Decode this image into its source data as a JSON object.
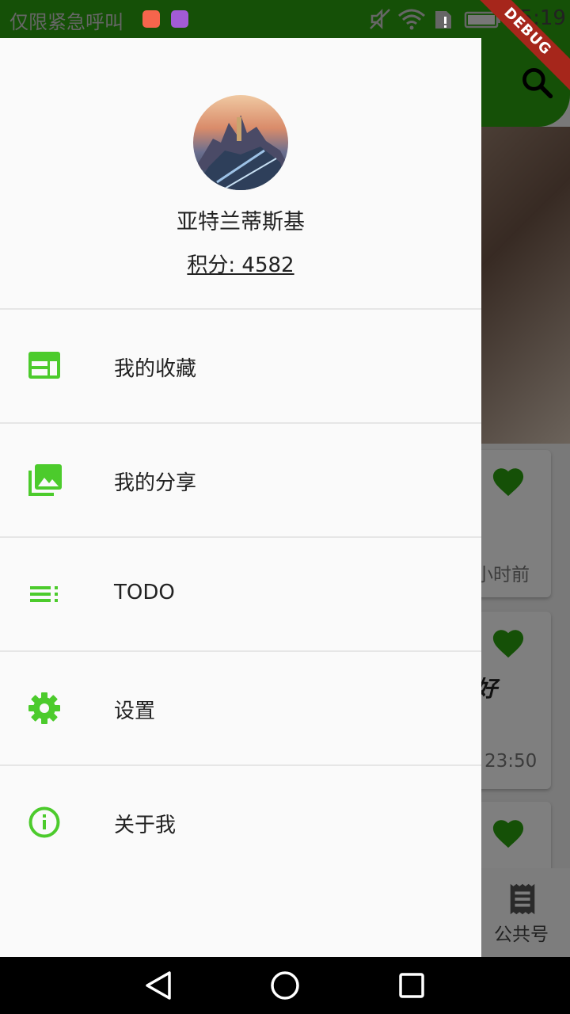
{
  "status_bar": {
    "carrier_text": "仅限紧急呼叫",
    "time": "15:19",
    "debug_label": "DEBUG",
    "icons": [
      "mail-badge-icon",
      "gallery-badge-icon",
      "mute-icon",
      "wifi-icon",
      "sim-alert-icon",
      "battery-icon"
    ]
  },
  "background_app": {
    "appbar_color": "#2aa10f",
    "cards": [
      {
        "partial_time": "小时前"
      },
      {
        "partial_title": "好",
        "partial_time": "23:50"
      },
      {}
    ],
    "bottom_nav_label": "公共号"
  },
  "drawer": {
    "username": "亚特兰蒂斯基",
    "points_label": "积分: 4582",
    "accent_color": "#4ccb2c",
    "menu_items": [
      {
        "label": "我的收藏",
        "icon": "web-favorites-icon"
      },
      {
        "label": "我的分享",
        "icon": "photo-library-icon"
      },
      {
        "label": "TODO",
        "icon": "playlist-icon"
      },
      {
        "label": "设置",
        "icon": "settings-gear-icon"
      },
      {
        "label": "关于我",
        "icon": "info-icon"
      }
    ]
  },
  "nav_bar": {
    "buttons": [
      "back-triangle-icon",
      "home-circle-icon",
      "recents-square-icon"
    ]
  }
}
